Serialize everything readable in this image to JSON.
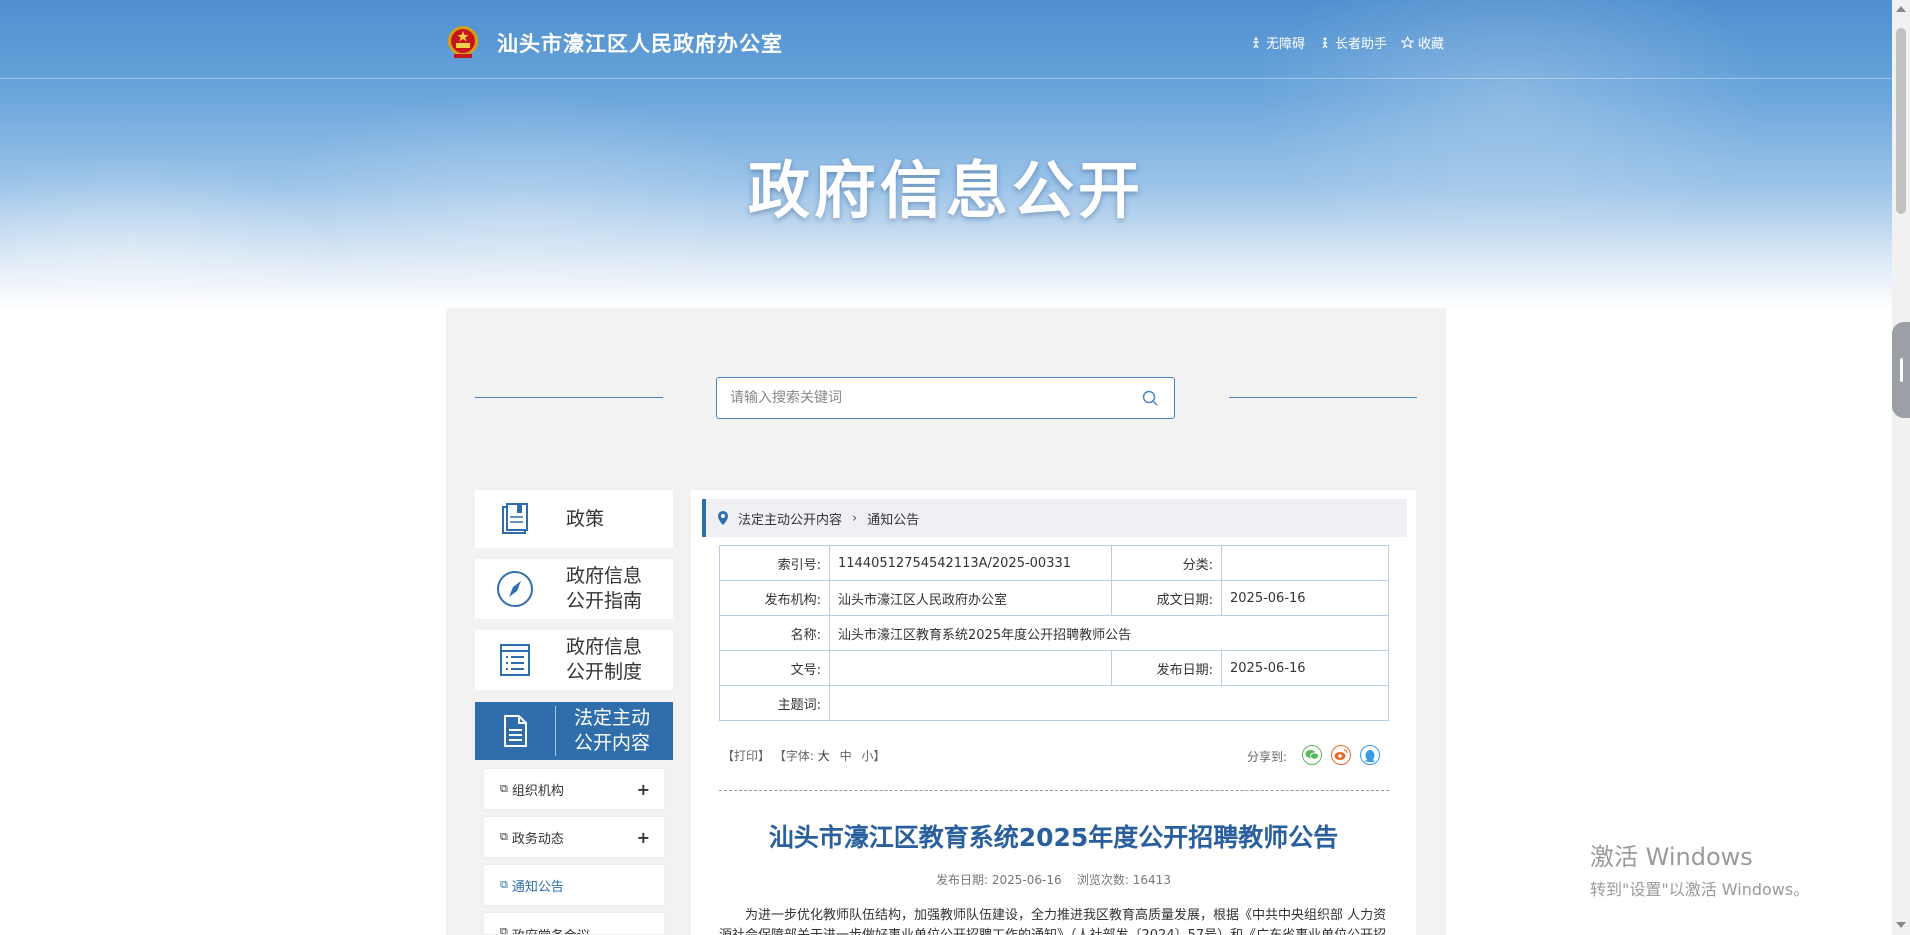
{
  "header": {
    "site_title": "汕头市濠江区人民政府办公室",
    "links": [
      {
        "label": "无障碍",
        "icon": "accessibility-icon"
      },
      {
        "label": "长者助手",
        "icon": "elder-assistant-icon"
      },
      {
        "label": "收藏",
        "icon": "star-icon"
      }
    ],
    "banner_title": "政府信息公开"
  },
  "search": {
    "placeholder": "请输入搜索关键词"
  },
  "nav": {
    "items": [
      {
        "label": "政策",
        "icon": "policy-book-icon"
      },
      {
        "label_line1": "政府信息",
        "label_line2": "公开指南",
        "icon": "compass-icon"
      },
      {
        "label_line1": "政府信息",
        "label_line2": "公开制度",
        "icon": "list-document-icon"
      },
      {
        "label_line1": "法定主动",
        "label_line2": "公开内容",
        "icon": "document-icon"
      }
    ],
    "sub_items": [
      {
        "label": "组织机构",
        "expand": "+"
      },
      {
        "label": "政务动态",
        "expand": "+"
      },
      {
        "label": "通知公告"
      },
      {
        "label": "政府常务会议"
      }
    ]
  },
  "breadcrumb": {
    "level1": "法定主动公开内容",
    "level2": "通知公告"
  },
  "meta": {
    "index_label": "索引号:",
    "index_value": "11440512754542113A/2025-00331",
    "category_label": "分类:",
    "category_value": "",
    "publisher_label": "发布机构:",
    "publisher_value": "汕头市濠江区人民政府办公室",
    "written_date_label": "成文日期:",
    "written_date_value": "2025-06-16",
    "name_label": "名称:",
    "name_value": "汕头市濠江区教育系统2025年度公开招聘教师公告",
    "doc_no_label": "文号:",
    "doc_no_value": "",
    "publish_date_label": "发布日期:",
    "publish_date_value": "2025-06-16",
    "keywords_label": "主题词:",
    "keywords_value": ""
  },
  "tools": {
    "print": "【打印】",
    "font_prefix": "【字体:",
    "font_large": "大",
    "font_medium": "中",
    "font_small": "小",
    "font_suffix": "】",
    "share_label": "分享到:"
  },
  "article": {
    "title": "汕头市濠江区教育系统2025年度公开招聘教师公告",
    "publish_date_label": "发布日期:",
    "publish_date": "2025-06-16",
    "views_label": "浏览次数:",
    "views": "16413",
    "body": "为进一步优化教师队伍结构，加强教师队伍建设，全力推进我区教育高质量发展，根据《中共中央组织部 人力资源社会保障部关于进一步做好事业单位公开招聘工作的通知》（人社部发〔2024〕57号）和《广东省事业单位公开招"
  },
  "windows_activation": {
    "line1": "激活 Windows",
    "line2": "转到\"设置\"以激活 Windows。"
  },
  "colors": {
    "brand_blue": "#2f6eab",
    "title_blue": "#2a5f9e",
    "border_blue": "#4a84c0"
  }
}
